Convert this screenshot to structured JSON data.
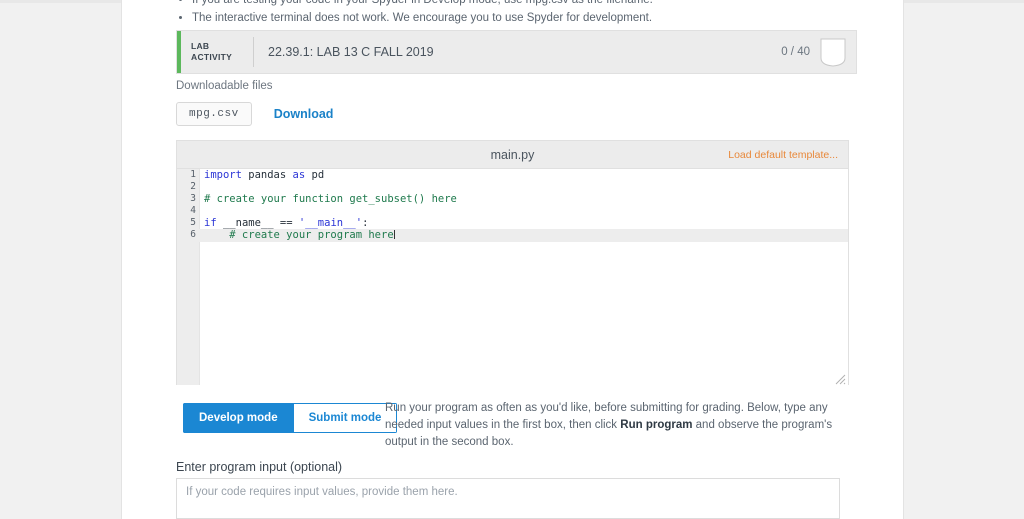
{
  "intro": {
    "bullets": [
      "If you are testing your code in your Spyder in Develop mode, use mpg.csv as the filename.",
      "The interactive terminal does not work. We encourage you to use Spyder for development."
    ]
  },
  "lab_header": {
    "tag_line1": "LAB",
    "tag_line2": "ACTIVITY",
    "title": "22.39.1: LAB 13 C FALL 2019",
    "score": "0 / 40",
    "badge_icon": "shield-badge-icon"
  },
  "downloads": {
    "label": "Downloadable files",
    "file_name": "mpg.csv",
    "download_label": "Download"
  },
  "editor": {
    "filename": "main.py",
    "template_link": "Load default template...",
    "lines": [
      {
        "n": "1",
        "tokens": [
          {
            "t": "import",
            "c": "kw"
          },
          {
            "t": " pandas ",
            "c": "plain"
          },
          {
            "t": "as",
            "c": "kw"
          },
          {
            "t": " pd",
            "c": "plain"
          }
        ]
      },
      {
        "n": "2",
        "tokens": []
      },
      {
        "n": "3",
        "tokens": [
          {
            "t": "# create your function get_subset() here",
            "c": "com"
          }
        ]
      },
      {
        "n": "4",
        "tokens": []
      },
      {
        "n": "5",
        "tokens": [
          {
            "t": "if",
            "c": "kw"
          },
          {
            "t": " __name__ == ",
            "c": "plain"
          },
          {
            "t": "'__main__'",
            "c": "str"
          },
          {
            "t": ":",
            "c": "plain"
          }
        ]
      },
      {
        "n": "6",
        "tokens": [
          {
            "t": "    # create your program here",
            "c": "com"
          }
        ],
        "active": true,
        "caret": true
      }
    ]
  },
  "modes": {
    "develop_label": "Develop mode",
    "submit_label": "Submit mode",
    "active": "develop"
  },
  "run_description": {
    "part1": "Run your program as often as you'd like, before submitting for grading. Below, type any needed input values in the first box, then click ",
    "bold": "Run program",
    "part2": " and observe the program's output in the second box."
  },
  "program_input": {
    "label": "Enter program input (optional)",
    "placeholder": "If your code requires input values, provide them here.",
    "value": ""
  },
  "colors": {
    "accent_green": "#5cb85c",
    "link_blue": "#1b82c8",
    "button_blue": "#1b87d3",
    "template_orange": "#e8883a",
    "page_bg": "#f1f1f1"
  }
}
